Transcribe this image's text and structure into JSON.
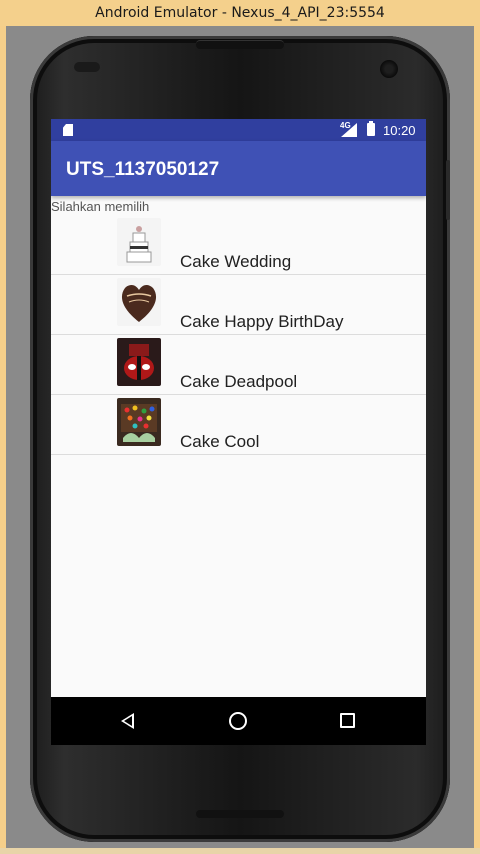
{
  "window": {
    "title": "Android Emulator - Nexus_4_API_23:5554"
  },
  "statusbar": {
    "network": "4G",
    "time": "10:20"
  },
  "app": {
    "title": "UTS_1137050127",
    "prompt": "Silahkan memilih"
  },
  "items": [
    {
      "label": "Cake Wedding",
      "icon": "wedding-cake-thumbnail"
    },
    {
      "label": "Cake Happy BirthDay",
      "icon": "birthday-cake-thumbnail"
    },
    {
      "label": "Cake Deadpool",
      "icon": "deadpool-cake-thumbnail"
    },
    {
      "label": "Cake Cool",
      "icon": "cool-cake-thumbnail"
    }
  ],
  "colors": {
    "statusbar": "#303f9f",
    "appbar": "#3f51b5",
    "navbar": "#000000"
  }
}
